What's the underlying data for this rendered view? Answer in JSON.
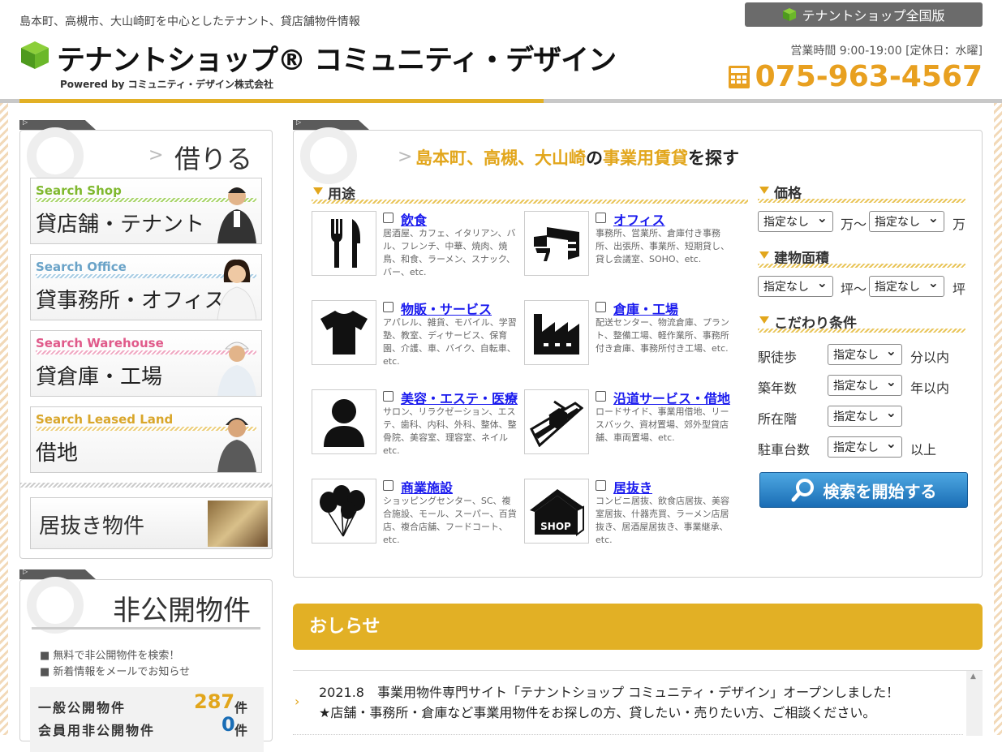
{
  "header": {
    "tagline": "島本町、高槻市、大山崎町を中心としたテナント、貸店舗物件情報",
    "logo_title": "テナントショップ® コミュニティ・デザイン",
    "logo_powered": "Powered by コミュニティ・デザイン株式会社",
    "national_button": "テナントショップ全国版",
    "hours": "営業時間 9:00-19:00 [定休日：水曜]",
    "phone": "075-963-4567",
    "accent_color": "#e2b025"
  },
  "rent": {
    "title": "借りる",
    "categories": [
      {
        "en": "Search Shop",
        "ja": "貸店舗・テナント",
        "color": "#7fb82e"
      },
      {
        "en": "Search Office",
        "ja": "貸事務所・オフィス",
        "color": "#6aa3c8"
      },
      {
        "en": "Search Warehouse",
        "ja": "貸倉庫・工場",
        "color": "#e05a8a"
      },
      {
        "en": "Search Leased Land",
        "ja": "借地",
        "color": "#d9a62a"
      }
    ],
    "iinuki": "居抜き物件"
  },
  "private": {
    "title": "非公開物件",
    "notes": [
      "無料で非公開物件を検索！",
      "新着情報をメールでお知らせ"
    ],
    "public_label": "一般公開物件",
    "public_count": "287",
    "member_label": "会員用非公開物件",
    "member_count": "0",
    "unit": "件"
  },
  "search": {
    "heading_area": "島本町、高槻、大山崎",
    "heading_no": "の",
    "heading_kind": "事業用賃貸",
    "heading_suffix": "を探す",
    "use_label": "用途",
    "uses": [
      {
        "name": "飲食",
        "desc": "居酒屋、カフェ、イタリアン、バル、フレンチ、中華、焼肉、焼鳥、和食、ラーメン、スナック、バー、etc.",
        "icon": "fork-knife-icon"
      },
      {
        "name": "オフィス",
        "desc": "事務所、営業所、倉庫付き事務所、出張所、事業所、短期貸し、貸し会議室、SOHO、etc.",
        "icon": "office-desk-icon"
      },
      {
        "name": "物販・サービス",
        "desc": "アパレル、雑貨、モバイル、学習塾、教室、ディサービス、保育園、介護、車、バイク、自転車、etc.",
        "icon": "tshirt-icon"
      },
      {
        "name": "倉庫・工場",
        "desc": "配送センター、物流倉庫、プラント、整備工場、軽作業所、事務所付き倉庫、事務所付き工場、etc.",
        "icon": "factory-icon"
      },
      {
        "name": "美容・エステ・医療",
        "desc": "サロン、リラクゼーション、エステ、歯科、内科、外科、整体、整骨院、美容室、理容室、ネイル etc.",
        "icon": "person-icon"
      },
      {
        "name": "沿道サービス・借地",
        "desc": "ロードサイド、事業用借地、リースバック、資材置場、郊外型貸店舗、車両置場、etc.",
        "icon": "roadside-icon"
      },
      {
        "name": "商業施設",
        "desc": "ショッピングセンター、SC、複合施設、モール、スーパー、百貨店、複合店舗、フードコート、etc.",
        "icon": "balloons-icon"
      },
      {
        "name": "居抜き",
        "desc": "コンビニ居抜、飲食店居抜、美容室居抜、什器売買、ラーメン店居抜き、居酒屋居抜き、事業継承、etc.",
        "icon": "shop-house-icon"
      }
    ],
    "price_label": "価格",
    "area_label": "建物面積",
    "cond_label": "こだわり条件",
    "none": "指定なし",
    "man_from": "万〜",
    "man": "万",
    "tsubo_from": "坪〜",
    "tsubo": "坪",
    "conditions": [
      {
        "label": "駅徒歩",
        "suffix": "分以内"
      },
      {
        "label": "築年数",
        "suffix": "年以内"
      },
      {
        "label": "所在階",
        "suffix": ""
      },
      {
        "label": "駐車台数",
        "suffix": "以上"
      }
    ],
    "button": "検索を開始する"
  },
  "news": {
    "title": "おしらせ",
    "line1": "2021.8　事業用物件専門サイト「テナントショップ コミュニティ・デザイン」オープンしました！",
    "line2": "★店舗・事務所・倉庫など事業用物件をお探しの方、貸したい・売りたい方、ご相談ください。"
  }
}
